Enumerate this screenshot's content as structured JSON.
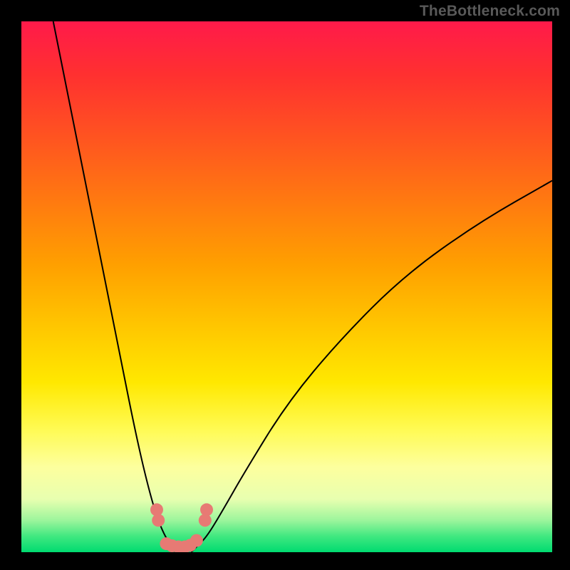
{
  "watermark": "TheBottleneck.com",
  "chart_data": {
    "type": "line",
    "title": "",
    "xlabel": "",
    "ylabel": "",
    "xlim": [
      0,
      100
    ],
    "ylim": [
      0,
      100
    ],
    "series": [
      {
        "name": "curve-left",
        "x": [
          6,
          10,
          14,
          18,
          22,
          25,
          27,
          28.5,
          29
        ],
        "y": [
          100,
          80,
          60,
          40,
          20,
          8,
          3,
          1,
          0
        ]
      },
      {
        "name": "curve-right",
        "x": [
          32,
          33,
          35,
          38,
          42,
          50,
          60,
          72,
          86,
          100
        ],
        "y": [
          0,
          1,
          3,
          8,
          15,
          28,
          40,
          52,
          62,
          70
        ]
      }
    ],
    "markers": {
      "name": "highlight-points",
      "color": "#e77a74",
      "points": [
        {
          "x": 25.5,
          "y": 8
        },
        {
          "x": 25.8,
          "y": 6
        },
        {
          "x": 27.3,
          "y": 1.6
        },
        {
          "x": 28.4,
          "y": 1.2
        },
        {
          "x": 29.6,
          "y": 1.0
        },
        {
          "x": 30.8,
          "y": 1.0
        },
        {
          "x": 31.8,
          "y": 1.3
        },
        {
          "x": 33.0,
          "y": 2.2
        },
        {
          "x": 34.6,
          "y": 6.0
        },
        {
          "x": 34.9,
          "y": 8.0
        }
      ]
    }
  }
}
